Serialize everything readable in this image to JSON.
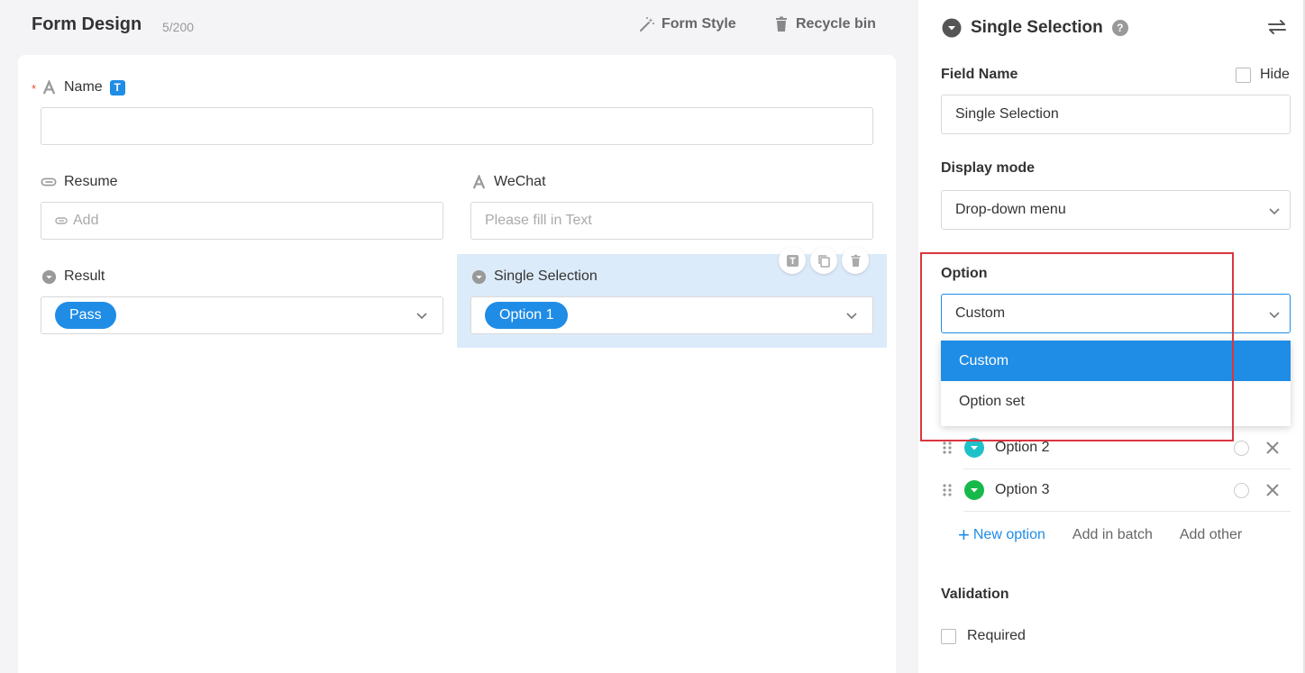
{
  "header": {
    "title": "Form Design",
    "count": "5/200",
    "form_style": "Form Style",
    "recycle_bin": "Recycle bin"
  },
  "form": {
    "name": {
      "label": "Name",
      "badge": "T",
      "value": ""
    },
    "resume": {
      "label": "Resume",
      "placeholder": "Add"
    },
    "wechat": {
      "label": "WeChat",
      "placeholder": "Please fill in Text"
    },
    "result": {
      "label": "Result",
      "value": "Pass"
    },
    "single_selection": {
      "label": "Single Selection",
      "value": "Option 1"
    }
  },
  "panel": {
    "title": "Single Selection",
    "help": "?",
    "field_name_label": "Field Name",
    "hide_label": "Hide",
    "field_name_value": "Single Selection",
    "display_mode_label": "Display mode",
    "display_mode_value": "Drop-down menu",
    "option_label": "Option",
    "option_source_value": "Custom",
    "option_source_menu": [
      "Custom",
      "Option set"
    ],
    "options": [
      {
        "label": "Option 2",
        "color": "#1fc1c9"
      },
      {
        "label": "Option 3",
        "color": "#18b94b"
      }
    ],
    "new_option": "New option",
    "add_in_batch": "Add in batch",
    "add_other": "Add other",
    "validation_label": "Validation",
    "required_label": "Required"
  },
  "colors": {
    "accent": "#1f8ce6",
    "highlight": "#dcebfa",
    "annotation": "#d9363e"
  }
}
